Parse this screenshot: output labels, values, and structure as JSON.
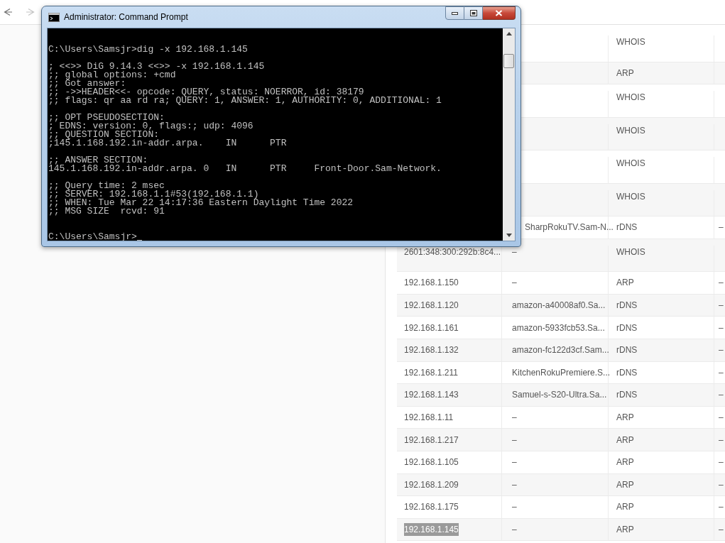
{
  "browser": {
    "nav": [
      {
        "kind": "back",
        "disabled": false
      },
      {
        "kind": "forward",
        "disabled": true
      }
    ]
  },
  "table": {
    "rows": [
      {
        "source": "WHOIS",
        "selected": false
      },
      {
        "source": "ARP",
        "selected": false
      },
      {
        "source": "WHOIS",
        "selected": false
      },
      {
        "source": "WHOIS",
        "selected": false
      },
      {
        "source": "WHOIS",
        "selected": false
      },
      {
        "source": "WHOIS",
        "selected": false
      },
      {
        "name": "SharpRokuTV.Sam-N...",
        "source": "rDNS",
        "column_4": "–",
        "selected": false
      },
      {
        "ip": "2601:348:300:292b:8c4...",
        "name": "–",
        "source": "WHOIS",
        "selected": false
      },
      {
        "ip": "192.168.1.150",
        "name": "–",
        "source": "ARP",
        "column_4": "–",
        "selected": false
      },
      {
        "ip": "192.168.1.120",
        "name": "amazon-a40008af0.Sa...",
        "source": "rDNS",
        "column_4": "–",
        "selected": false
      },
      {
        "ip": "192.168.1.161",
        "name": "amazon-5933fcb53.Sa...",
        "source": "rDNS",
        "column_4": "–",
        "selected": false
      },
      {
        "ip": "192.168.1.132",
        "name": "amazon-fc122d3cf.Sam...",
        "source": "rDNS",
        "column_4": "–",
        "selected": false
      },
      {
        "ip": "192.168.1.211",
        "name": "KitchenRokuPremiere.S...",
        "source": "rDNS",
        "column_4": "–",
        "selected": false
      },
      {
        "ip": "192.168.1.143",
        "name": "Samuel-s-S20-Ultra.Sa...",
        "source": "rDNS",
        "column_4": "–",
        "selected": false
      },
      {
        "ip": "192.168.1.11",
        "name": "–",
        "source": "ARP",
        "column_4": "–",
        "selected": false
      },
      {
        "ip": "192.168.1.217",
        "name": "–",
        "source": "ARP",
        "column_4": "–",
        "selected": false
      },
      {
        "ip": "192.168.1.105",
        "name": "–",
        "source": "ARP",
        "column_4": "–",
        "selected": false
      },
      {
        "ip": "192.168.1.209",
        "name": "–",
        "source": "ARP",
        "column_4": "–",
        "selected": false
      },
      {
        "ip": "192.168.1.175",
        "name": "–",
        "source": "ARP",
        "column_4": "–",
        "selected": false
      },
      {
        "ip": "192.168.1.145",
        "name": "–",
        "source": "ARP",
        "column_4": "–",
        "selected": true
      }
    ]
  },
  "window": {
    "title": "Administrator: Command Prompt",
    "console": {
      "blocks": [
        [
          "C:\\Users\\Samsjr>dig -x 192.168.1.145"
        ],
        [
          "; <<>> DiG 9.14.3 <<>> -x 192.168.1.145",
          ";; global options: +cmd",
          ";; Got answer:",
          ";; ->>HEADER<<- opcode: QUERY, status: NOERROR, id: 38179",
          ";; flags: qr aa rd ra; QUERY: 1, ANSWER: 1, AUTHORITY: 0, ADDITIONAL: 1"
        ],
        [
          ";; OPT PSEUDOSECTION:",
          "; EDNS: version: 0, flags:; udp: 4096",
          ";; QUESTION SECTION:",
          ";145.1.168.192.in-addr.arpa.    IN      PTR"
        ],
        [
          ";; ANSWER SECTION:",
          "145.1.168.192.in-addr.arpa. 0   IN      PTR     Front-Door.Sam-Network."
        ],
        [
          ";; Query time: 2 msec",
          ";; SERVER: 192.168.1.1#53(192.168.1.1)",
          ";; WHEN: Tue Mar 22 14:17:36 Eastern Daylight Time 2022",
          ";; MSG SIZE  rcvd: 91"
        ]
      ],
      "prompt": "C:\\Users\\Samsjr>"
    }
  }
}
